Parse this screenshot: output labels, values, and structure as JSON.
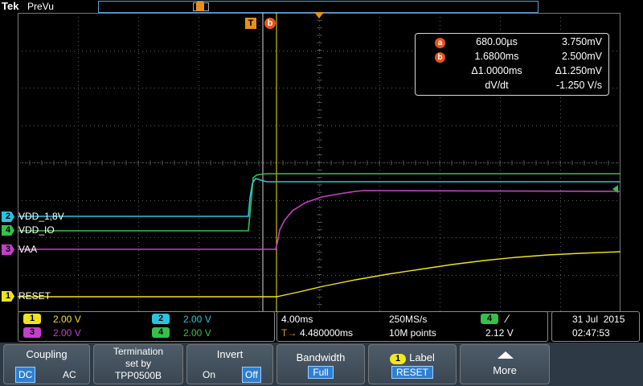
{
  "header": {
    "brand": "Tek",
    "mode": "PreVu"
  },
  "markers": {
    "trigger_marker": "T",
    "cursor_b_marker": "b"
  },
  "cursor_readout": {
    "a_label": "a",
    "a_time": "680.00µs",
    "a_volt": "3.750mV",
    "b_label": "b",
    "b_time": "1.6800ms",
    "b_volt": "2.500mV",
    "delta_time": "Δ1.0000ms",
    "delta_volt": "Δ1.250mV",
    "slope_label": "dV/dt",
    "slope_value": "-1.250 V/s"
  },
  "channels": [
    {
      "num": "2",
      "name": "VDD_1,8V",
      "color": "#29c4e0"
    },
    {
      "num": "4",
      "name": "VDD_IO",
      "color": "#35c04a"
    },
    {
      "num": "3",
      "name": "VAA",
      "color": "#c53fc8"
    },
    {
      "num": "1",
      "name": "RESET",
      "color": "#f0e21c"
    }
  ],
  "vertical": {
    "ch1": {
      "num": "1",
      "scale": "2.00 V"
    },
    "ch2": {
      "num": "2",
      "scale": "2.00 V"
    },
    "ch3": {
      "num": "3",
      "scale": "2.00 V"
    },
    "ch4": {
      "num": "4",
      "scale": "2.00 V"
    }
  },
  "horizontal": {
    "timebase": "4.00ms",
    "sample_rate": "250MS/s",
    "position": "4.480000ms",
    "record": "10M points",
    "trigger_position_prefix": "T→"
  },
  "trigger": {
    "source": "4",
    "slope_symbol": "⁄",
    "level": "2.12 V"
  },
  "datetime": {
    "date": "31 Jul  2015",
    "time": "02:47:53"
  },
  "menu": {
    "coupling": {
      "title": "Coupling",
      "opt1": "DC",
      "opt2": "AC"
    },
    "termination": {
      "line1": "Termination",
      "line2": "set by",
      "line3": "TPP0500B"
    },
    "invert": {
      "title": "Invert",
      "opt1": "On",
      "opt2": "Off"
    },
    "bandwidth": {
      "title": "Bandwidth",
      "value": "Full"
    },
    "label": {
      "badge": "1",
      "title": "Label",
      "value": "RESET"
    },
    "more": {
      "title": "More",
      "icon": "triangle-up-icon"
    }
  }
}
